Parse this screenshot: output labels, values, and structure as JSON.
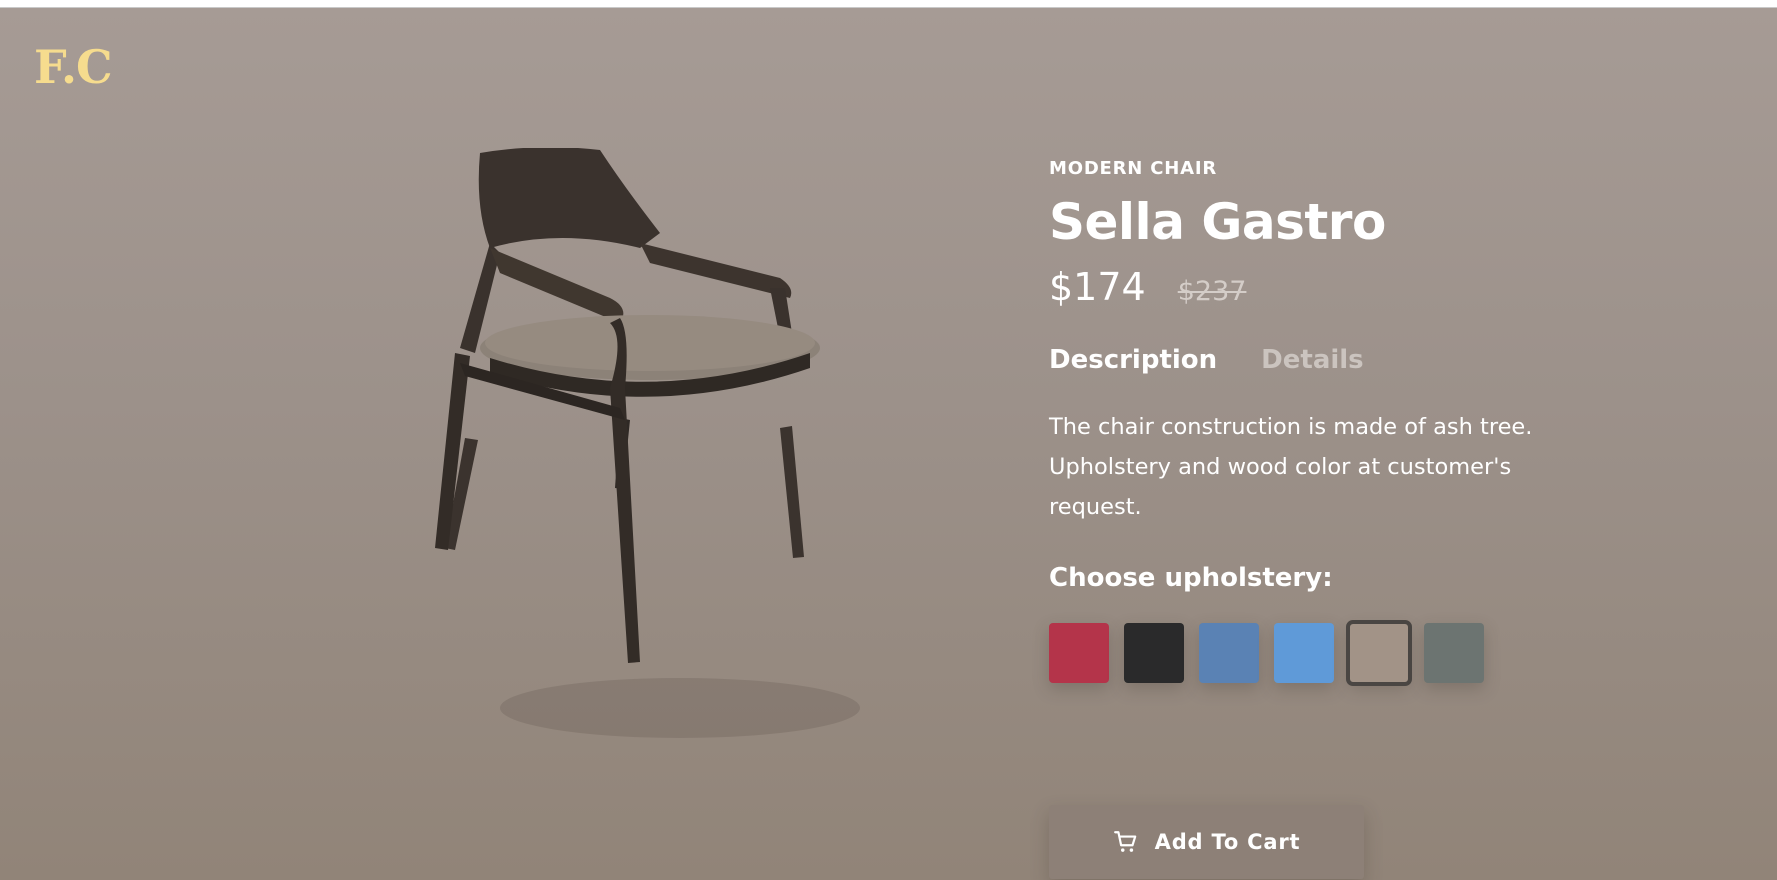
{
  "brand": {
    "logo_text": "F.C"
  },
  "product": {
    "category": "MODERN CHAIR",
    "name": "Sella Gastro",
    "price": "$174",
    "old_price": "$237",
    "tabs": [
      {
        "label": "Description",
        "active": true
      },
      {
        "label": "Details",
        "active": false
      }
    ],
    "description": "The chair construction is made of ash tree. Upholstery and wood color at customer's request.",
    "upholstery_label": "Choose upholstery:",
    "upholstery_options": [
      {
        "name": "red",
        "color": "#b4344a"
      },
      {
        "name": "black",
        "color": "#2a2a2b"
      },
      {
        "name": "denim-blue",
        "color": "#5a82b4"
      },
      {
        "name": "light-blue",
        "color": "#5f9ad8"
      },
      {
        "name": "beige",
        "color": "#a29387",
        "selected": true
      },
      {
        "name": "grey-green",
        "color": "#6c7471"
      }
    ]
  },
  "actions": {
    "add_to_cart_label": "Add To Cart",
    "cart_icon": "cart-icon"
  },
  "colors": {
    "background": "#a09590",
    "logo": "#f6dc8e",
    "button": "#8d8077"
  }
}
